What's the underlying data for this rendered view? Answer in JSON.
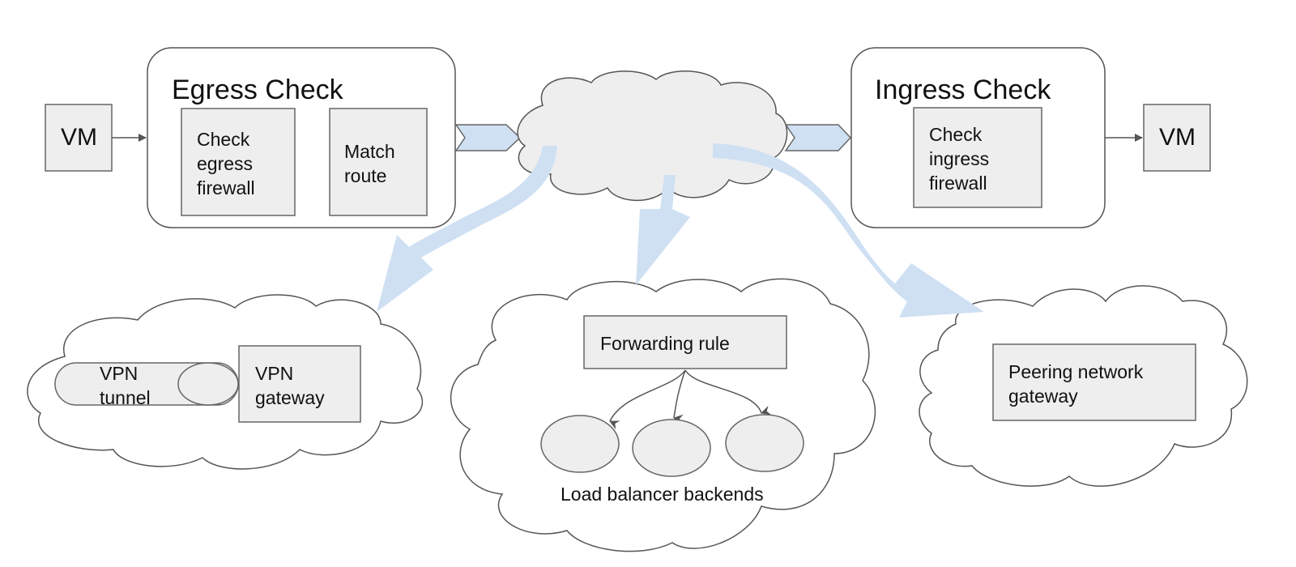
{
  "diagram": {
    "source_vm": {
      "label": "VM"
    },
    "dest_vm": {
      "label": "VM"
    },
    "egress": {
      "title": "Egress Check",
      "steps": [
        {
          "label": "Check\negress\nfirewall"
        },
        {
          "label": "Match\nroute"
        }
      ]
    },
    "ingress": {
      "title": "Ingress Check",
      "steps": [
        {
          "label": "Check\ningress\nfirewall"
        }
      ]
    },
    "destinations": {
      "vpn": {
        "tunnel_label": "VPN\ntunnel",
        "gateway_label": "VPN\ngateway"
      },
      "load_balancer": {
        "rule_label": "Forwarding rule",
        "backends_label": "Load balancer backends",
        "backend_count": 3
      },
      "peering": {
        "gateway_label": "Peering network\ngateway"
      }
    },
    "colors": {
      "box_fill": "#eeeeee",
      "stroke": "#555555",
      "flow_arrow": "#cfe0f3",
      "chevron_fill": "#cfe0f3"
    }
  }
}
